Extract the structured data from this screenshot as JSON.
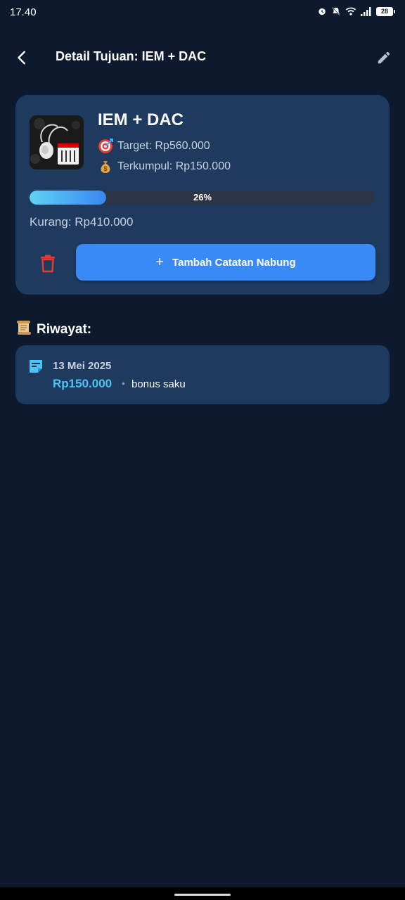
{
  "status": {
    "time": "17.40",
    "battery": "28",
    "icons": [
      "alarm-icon",
      "bell-off-icon",
      "wifi-icon",
      "signal-icon",
      "battery-icon"
    ]
  },
  "appbar": {
    "title": "Detail Tujuan: IEM + DAC",
    "back_icon": "chevron-left-icon",
    "edit_icon": "pencil-icon"
  },
  "goal": {
    "name": "IEM + DAC",
    "target_label": "Target: Rp560.000",
    "collected_label": "Terkumpul: Rp150.000",
    "progress_text": "26%",
    "progress_fraction": 0.26,
    "remaining_label": "Kurang: Rp410.000",
    "add_button_label": "Tambah Catatan Nabung",
    "target_icon": "target-emoji",
    "collected_icon": "money-bag-emoji",
    "delete_icon": "trash-icon"
  },
  "history": {
    "title": "Riwayat:",
    "title_icon": "scroll-emoji",
    "items": [
      {
        "date": "13 Mei 2025",
        "amount": "Rp150.000",
        "note": "bonus saku",
        "separator": "•"
      }
    ]
  },
  "colors": {
    "background": "#0d1a2e",
    "card": "#1f3a5f",
    "accent": "#3a8af5",
    "amount": "#4fc3f7",
    "delete": "#e53935"
  }
}
